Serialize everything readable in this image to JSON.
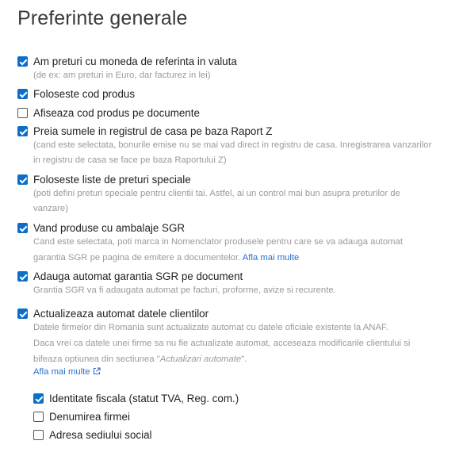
{
  "page": {
    "title": "Preferinte generale"
  },
  "options": [
    {
      "label": "Am preturi cu moneda de referinta in valuta",
      "checked": true,
      "description": [
        "(de ex: am preturi in Euro, dar facturez in lei)"
      ]
    },
    {
      "label": "Foloseste cod produs",
      "checked": true,
      "description": []
    },
    {
      "label": "Afiseaza cod produs pe documente",
      "checked": false,
      "description": []
    },
    {
      "label": "Preia sumele in registrul de casa pe baza Raport Z",
      "checked": true,
      "description": [
        "(cand este selectata, bonurile emise nu se mai vad direct in registru de casa. Inregistrarea vanzarilor",
        "in registru de casa se face pe baza Raportului Z)"
      ]
    },
    {
      "label": "Foloseste liste de preturi speciale",
      "checked": true,
      "description": [
        "(poti defini preturi speciale pentru clientii tai. Astfel, ai un control mai bun asupra preturilor de",
        "vanzare)"
      ]
    },
    {
      "label": "Vand produse cu ambalaje SGR",
      "checked": true,
      "description": [
        "Cand este selectata, poti marca in Nomenclator produsele pentru care se va adauga automat",
        "garantia SGR pe pagina de emitere a documentelor."
      ],
      "link": "Afla mai multe"
    },
    {
      "label": "Adauga automat garantia SGR pe document",
      "checked": true,
      "description": [
        "Grantia SGR va fi adaugata automat pe facturi, proforme, avize si recurente."
      ]
    },
    {
      "label": "Actualizeaza automat datele clientilor",
      "checked": true,
      "description": [
        "Datele firmelor din Romania sunt actualizate automat cu datele oficiale existente la ANAF.",
        "Daca vrei ca datele unei firme sa nu fie actualizate automat, acceseaza modificarile clientului si",
        "bifeaza optiunea din sectiunea \"",
        "Actualizari automate",
        "\"."
      ],
      "link": "Afla mai multe",
      "suboptions": [
        {
          "label": "Identitate fiscala (statut TVA, Reg. com.)",
          "checked": true
        },
        {
          "label": "Denumirea firmei",
          "checked": false
        },
        {
          "label": "Adresa sediului social",
          "checked": false
        }
      ]
    }
  ],
  "colors": {
    "accent": "#0b6ec9",
    "link": "#2b6fcb",
    "muted": "#9a9a9a"
  }
}
